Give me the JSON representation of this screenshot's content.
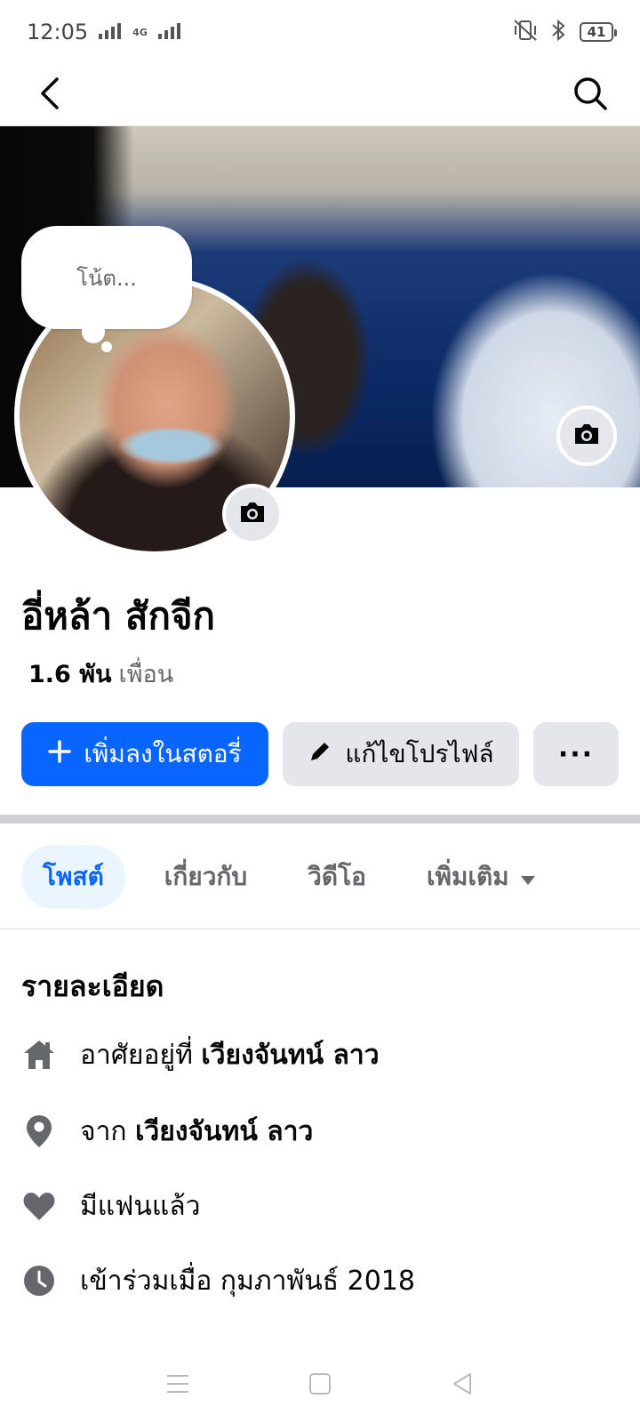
{
  "status_bar": {
    "time": "12:05",
    "network": "4G",
    "battery": "41"
  },
  "top_nav": {
    "back_icon": "chevron-left-icon",
    "search_icon": "search-icon"
  },
  "note": {
    "placeholder": "โน้ต..."
  },
  "profile": {
    "name": "อี่หล้า สักจีก",
    "friends_count": "1.6 พัน",
    "friends_label": "เพื่อน"
  },
  "actions": {
    "add_story": "เพิ่มลงในสตอรี่",
    "edit_profile": "แก้ไขโปรไฟล์",
    "more": "···"
  },
  "tabs": {
    "posts": "โพสต์",
    "about": "เกี่ยวกับ",
    "videos": "วิดีโอ",
    "more": "เพิ่มเติม"
  },
  "details": {
    "title": "รายละเอียด",
    "lives_prefix": "อาศัยอยู่ที่",
    "lives_value": "เวียงจันทน์ ลาว",
    "from_prefix": "จาก",
    "from_value": "เวียงจันทน์ ลาว",
    "relationship": "มีแฟนแล้ว",
    "joined": "เข้าร่วมเมื่อ กุมภาพันธ์ 2018"
  },
  "colors": {
    "primary": "#0866ff",
    "secondary_bg": "#e4e6eb",
    "muted": "#65676b",
    "tab_active_bg": "#ebf5ff"
  }
}
